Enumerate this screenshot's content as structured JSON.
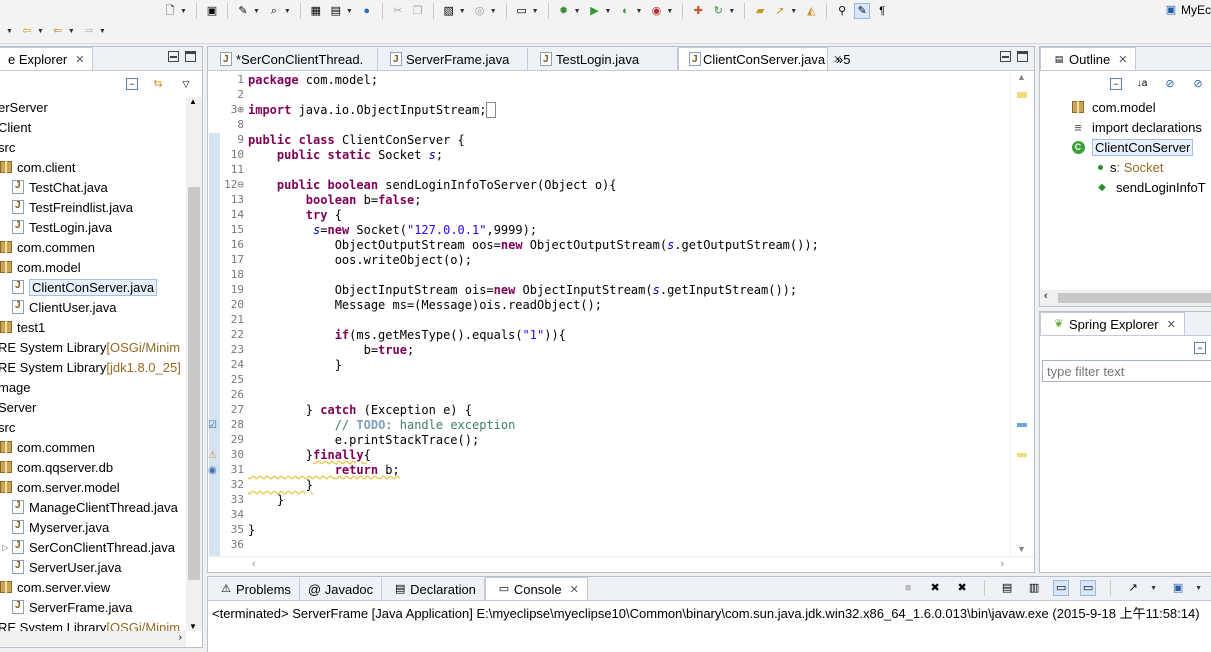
{
  "toolbar": {
    "right_label": "MyEc",
    "icons": [
      "new-wizard-icon",
      "print-icon",
      "run-dropdown-icon",
      "search-icon",
      "deploy-icon",
      "server-icon",
      "globe-icon",
      "cut-icon",
      "copy-icon",
      "open-type-icon",
      "browser-icon",
      "console-icon",
      "debug-icon",
      "run-icon",
      "coverage-icon",
      "external-tools-icon",
      "perspective-icon",
      "refresh-icon",
      "folder-icon",
      "flash-icon",
      "pin-icon",
      "highlight-icon",
      "pilcrow-icon"
    ],
    "row2_icons": [
      "back-arrow-icon",
      "back-icon",
      "forward-icon"
    ]
  },
  "explorer": {
    "tab_label": "e Explorer",
    "close": "✕",
    "items": [
      {
        "label": "erServer",
        "type": "text",
        "indent": 0
      },
      {
        "label": "Client",
        "type": "text",
        "indent": 0
      },
      {
        "label": "src",
        "type": "text",
        "indent": 0
      },
      {
        "label": "com.client",
        "type": "package",
        "indent": 1
      },
      {
        "label": "TestChat.java",
        "type": "java",
        "indent": 2
      },
      {
        "label": "TestFreindlist.java",
        "type": "java",
        "indent": 2
      },
      {
        "label": "TestLogin.java",
        "type": "java",
        "indent": 2
      },
      {
        "label": "com.commen",
        "type": "package",
        "indent": 1
      },
      {
        "label": "com.model",
        "type": "package",
        "indent": 1
      },
      {
        "label": "ClientConServer.java",
        "type": "java",
        "indent": 2,
        "selected": true
      },
      {
        "label": "ClientUser.java",
        "type": "java",
        "indent": 2
      },
      {
        "label": "test1",
        "type": "package",
        "indent": 1
      },
      {
        "label": "RE System Library ",
        "suffix": "[OSGi/Minim",
        "type": "lib",
        "indent": 0
      },
      {
        "label": "RE System Library ",
        "suffix": "[jdk1.8.0_25]",
        "type": "lib",
        "indent": 0
      },
      {
        "label": "mage",
        "type": "text",
        "indent": 0
      },
      {
        "label": "Server",
        "type": "text",
        "indent": 0
      },
      {
        "label": "src",
        "type": "text",
        "indent": 0
      },
      {
        "label": "com.commen",
        "type": "package",
        "indent": 1
      },
      {
        "label": "com.qqserver.db",
        "type": "package",
        "indent": 1
      },
      {
        "label": "com.server.model",
        "type": "package",
        "indent": 1
      },
      {
        "label": "ManageClientThread.java",
        "type": "java",
        "indent": 2
      },
      {
        "label": "Myserver.java",
        "type": "java",
        "indent": 2
      },
      {
        "label": "SerConClientThread.java",
        "type": "java",
        "indent": 2
      },
      {
        "label": "ServerUser.java",
        "type": "java",
        "indent": 2
      },
      {
        "label": "com.server.view",
        "type": "package",
        "indent": 1
      },
      {
        "label": "ServerFrame.java",
        "type": "java",
        "indent": 2
      },
      {
        "label": "RE System Library ",
        "suffix": "[OSGi/Minim",
        "type": "lib",
        "indent": 0
      }
    ]
  },
  "editor": {
    "tabs": [
      {
        "label": "*SerConClientThread.",
        "active": false
      },
      {
        "label": "ServerFrame.java",
        "active": false
      },
      {
        "label": "TestLogin.java",
        "active": false
      },
      {
        "label": "ClientConServer.java",
        "active": true
      }
    ],
    "overflow_label": "»5",
    "lines": [
      {
        "n": "1",
        "html": "<span class='kw'>package</span> com.model;"
      },
      {
        "n": "2",
        "html": ""
      },
      {
        "n": "3⊕",
        "html": "<span class='kw'>import</span> java.io.ObjectInputStream;<span style='border:1px solid #888;'>&nbsp;</span>"
      },
      {
        "n": "8",
        "html": ""
      },
      {
        "n": "9",
        "html": "<span class='kw'>public</span> <span class='kw'>class</span> ClientConServer {"
      },
      {
        "n": "10",
        "html": "    <span class='kw'>public</span> <span class='kw'>static</span> Socket <span class='fld-i'>s</span>;"
      },
      {
        "n": "11",
        "html": ""
      },
      {
        "n": "12⊖",
        "html": "    <span class='kw'>public</span> <span class='kw'>boolean</span> sendLoginInfoToServer(Object o){"
      },
      {
        "n": "13",
        "html": "        <span class='kw'>boolean</span> b=<span class='kw'>false</span>;"
      },
      {
        "n": "14",
        "html": "        <span class='kw'>try</span> {"
      },
      {
        "n": "15",
        "html": "         <span class='fld-i'>s</span>=<span class='kw'>new</span> Socket(<span class='str'>\"127.0.0.1\"</span>,9999);"
      },
      {
        "n": "16",
        "html": "            ObjectOutputStream oos=<span class='kw'>new</span> ObjectOutputStream(<span class='fld-i'>s</span>.getOutputStream());"
      },
      {
        "n": "17",
        "html": "            oos.writeObject(o);"
      },
      {
        "n": "18",
        "html": ""
      },
      {
        "n": "19",
        "html": "            ObjectInputStream ois=<span class='kw'>new</span> ObjectInputStream(<span class='fld-i'>s</span>.getInputStream());"
      },
      {
        "n": "20",
        "html": "            Message ms=(Message)ois.readObject();"
      },
      {
        "n": "21",
        "html": ""
      },
      {
        "n": "22",
        "html": "            <span class='kw'>if</span>(ms.getMesType().equals(<span class='str'>\"1\"</span>)){"
      },
      {
        "n": "23",
        "html": "                b=<span class='kw'>true</span>;"
      },
      {
        "n": "24",
        "html": "            }"
      },
      {
        "n": "25",
        "html": ""
      },
      {
        "n": "26",
        "html": ""
      },
      {
        "n": "27",
        "html": "        } <span class='kw'>catch</span> (Exception e) {"
      },
      {
        "n": "28",
        "html": "            <span class='cm'>// <span class='todo'>TODO</span>: handle exception</span>"
      },
      {
        "n": "29",
        "html": "            e.printStackTrace();"
      },
      {
        "n": "30",
        "html": "        }<span class='kw warn-ul'>finally</span><span class='warn-ul'>{</span>"
      },
      {
        "n": "31",
        "html": "<span class='warn-ul'>            </span><span class='kw warn-ul'>return</span><span class='warn-ul'> b;</span>"
      },
      {
        "n": "32",
        "html": "<span class='warn-ul'>        }</span>"
      },
      {
        "n": "33",
        "html": "    }"
      },
      {
        "n": "34",
        "html": ""
      },
      {
        "n": "35",
        "html": "}"
      },
      {
        "n": "36",
        "html": ""
      }
    ]
  },
  "outline": {
    "tab_label": "Outline",
    "items": [
      {
        "label": "com.model",
        "type": "package"
      },
      {
        "label": "import declarations",
        "type": "imports"
      },
      {
        "label": "ClientConServer",
        "type": "class",
        "selected": true
      },
      {
        "label": "s",
        "type_suffix": " : Socket",
        "type": "field"
      },
      {
        "label": "sendLoginInfoT",
        "type": "method"
      }
    ]
  },
  "spring": {
    "tab_label": "Spring Explorer",
    "filter_placeholder": "type filter text"
  },
  "bottom": {
    "tabs": [
      {
        "label": "Problems",
        "active": false
      },
      {
        "label": "@ Javadoc",
        "active": false
      },
      {
        "label": "Declaration",
        "active": false
      },
      {
        "label": "Console",
        "active": true
      }
    ],
    "console_line": "<terminated> ServerFrame [Java Application] E:\\myeclipse\\myeclipse10\\Common\\binary\\com.sun.java.jdk.win32.x86_64_1.6.0.013\\bin\\javaw.exe (2015-9-18 上午11:58:14)"
  }
}
